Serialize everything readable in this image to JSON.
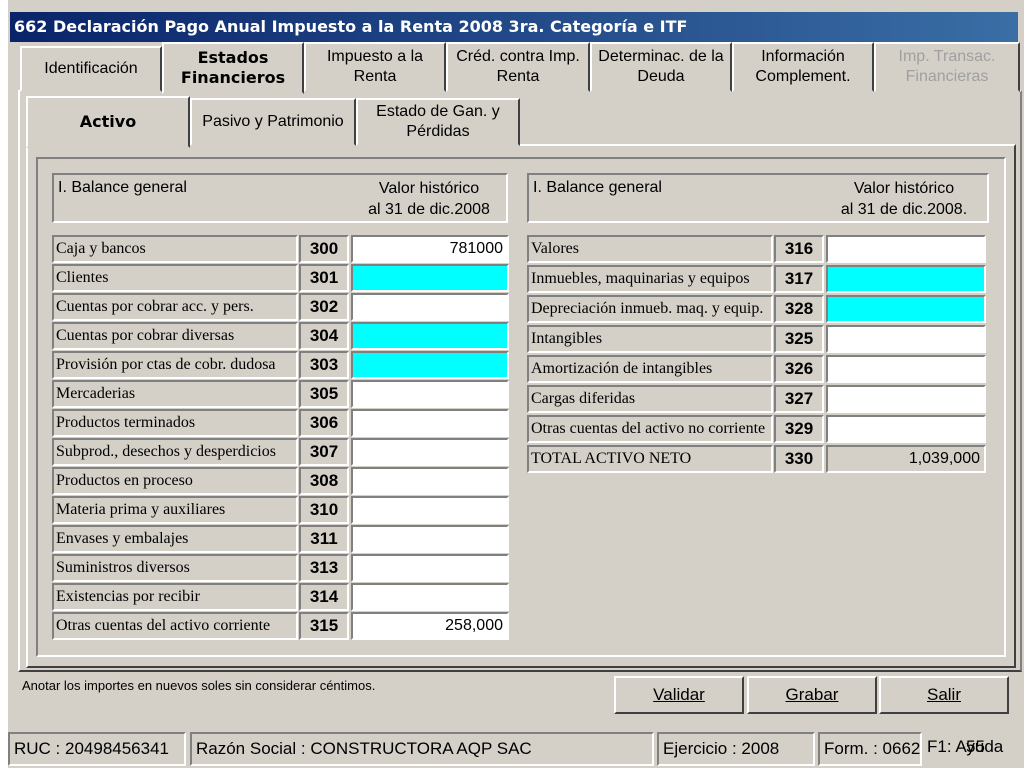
{
  "window": {
    "title": "662 Declaración Pago Anual Impuesto a la Renta 2008 3ra. Categoría e ITF"
  },
  "tabs": [
    {
      "line1": "Identificación",
      "line2": ""
    },
    {
      "line1": "Estados",
      "line2": "Financieros"
    },
    {
      "line1": "Impuesto a  la",
      "line2": "Renta"
    },
    {
      "line1": "Créd. contra Imp.",
      "line2": "Renta"
    },
    {
      "line1": "Determinac. de la",
      "line2": "Deuda"
    },
    {
      "line1": "Información",
      "line2": "Complement."
    },
    {
      "line1": "Imp. Transac.",
      "line2": "Financieras"
    }
  ],
  "subtabs": [
    {
      "line1": "Activo",
      "line2": ""
    },
    {
      "line1": "Pasivo y Patrimonio",
      "line2": ""
    },
    {
      "line1": "Estado de Gan. y",
      "line2": "Pérdidas"
    }
  ],
  "left_header": {
    "title": "I. Balance general",
    "value_line1": "Valor histórico",
    "value_line2": "al 31 de dic.2008"
  },
  "right_header": {
    "title": "I. Balance general",
    "value_line1": "Valor histórico",
    "value_line2": "al 31 de dic.2008."
  },
  "left_rows": [
    {
      "label": "Caja y bancos",
      "code": "300",
      "value": "781000",
      "color": "#ffffff"
    },
    {
      "label": "Clientes",
      "code": "301",
      "value": "",
      "color": "#00ffff"
    },
    {
      "label": "Cuentas por cobrar acc. y pers.",
      "code": "302",
      "value": "",
      "color": "#ffffff"
    },
    {
      "label": "Cuentas por cobrar diversas",
      "code": "304",
      "value": "",
      "color": "#00ffff"
    },
    {
      "label": "Provisión por ctas de cobr. dudosa",
      "code": "303",
      "value": "",
      "color": "#00ffff"
    },
    {
      "label": "Mercaderias",
      "code": "305",
      "value": "",
      "color": "#ffffff"
    },
    {
      "label": "Productos terminados",
      "code": "306",
      "value": "",
      "color": "#ffffff"
    },
    {
      "label": "Subprod., desechos y desperdicios",
      "code": "307",
      "value": "",
      "color": "#ffffff"
    },
    {
      "label": "Productos en proceso",
      "code": "308",
      "value": "",
      "color": "#ffffff"
    },
    {
      "label": "Materia prima y auxiliares",
      "code": "310",
      "value": "",
      "color": "#ffffff"
    },
    {
      "label": "Envases y embalajes",
      "code": "311",
      "value": "",
      "color": "#ffffff"
    },
    {
      "label": "Suministros diversos",
      "code": "313",
      "value": "",
      "color": "#ffffff"
    },
    {
      "label": "Existencias por recibir",
      "code": "314",
      "value": "",
      "color": "#ffffff"
    },
    {
      "label": "Otras cuentas del activo corriente",
      "code": "315",
      "value": "258,000",
      "color": "#ffffff"
    }
  ],
  "right_rows": [
    {
      "label": "Valores",
      "code": "316",
      "value": "",
      "color": "#ffffff"
    },
    {
      "label": "Inmuebles, maquinarias y equipos",
      "code": "317",
      "value": "",
      "color": "#00ffff"
    },
    {
      "label": "Depreciación inmueb. maq. y equip.",
      "code": "328",
      "value": "",
      "color": "#00ffff"
    },
    {
      "label": "Intangibles",
      "code": "325",
      "value": "",
      "color": "#ffffff"
    },
    {
      "label": "Amortización de intangibles",
      "code": "326",
      "value": "",
      "color": "#ffffff"
    },
    {
      "label": "Cargas diferidas",
      "code": "327",
      "value": "",
      "color": "#ffffff"
    },
    {
      "label": "Otras cuentas del activo no corriente",
      "code": "329",
      "value": "",
      "color": "#ffffff"
    },
    {
      "label": "TOTAL ACTIVO NETO",
      "code": "330",
      "value": "1,039,000",
      "color": "#d4d0c8"
    }
  ],
  "note": "Anotar los importes en nuevos soles sin considerar céntimos.",
  "buttons": {
    "validar": "Validar",
    "grabar": "Grabar",
    "salir": "Salir"
  },
  "status": {
    "ruc": "RUC : 20498456341",
    "razon": "Razón Social : CONSTRUCTORA AQP SAC",
    "ejercicio": "Ejercicio : 2008",
    "form": "Form. : 0662",
    "help": "F1: Ayuda",
    "page": "55"
  }
}
